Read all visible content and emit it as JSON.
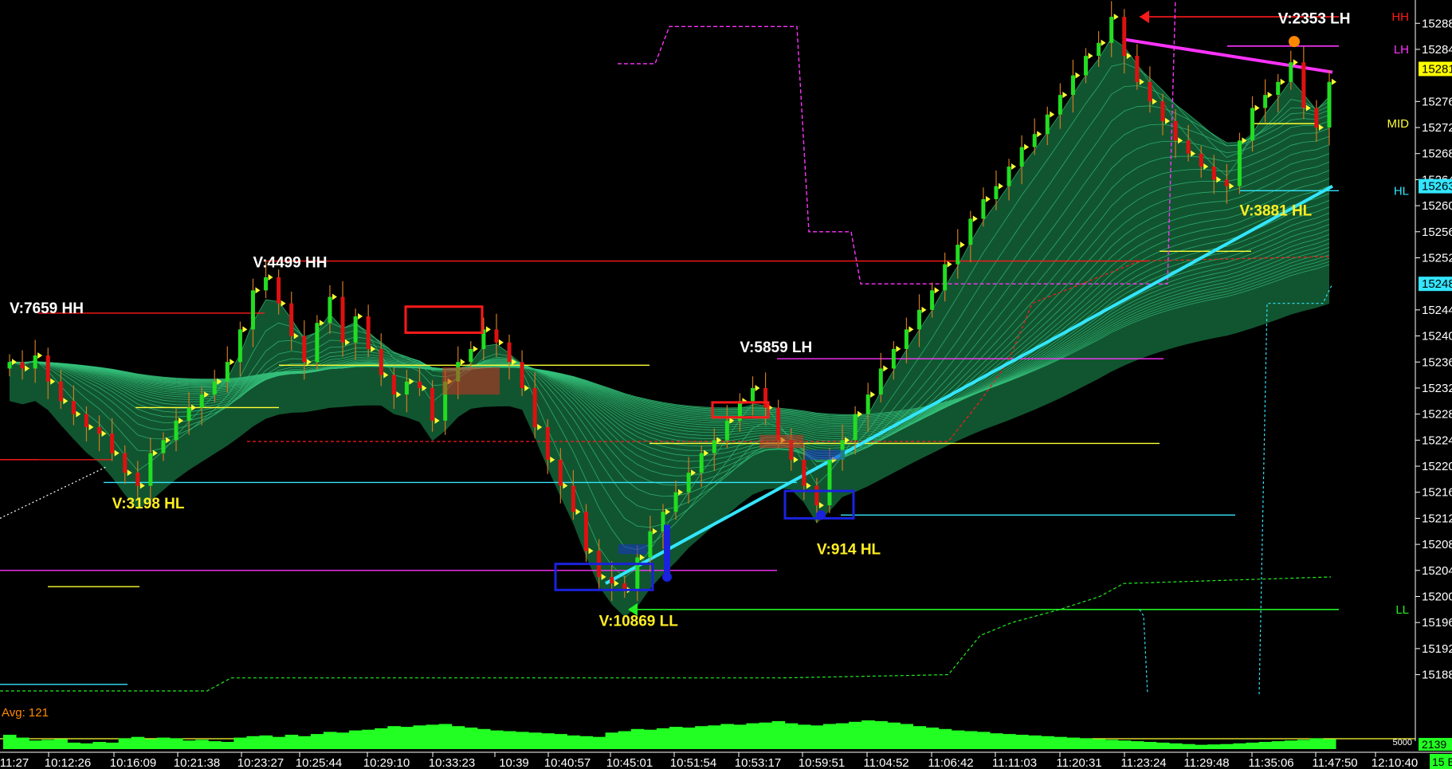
{
  "chart_data": {
    "type": "candlestick",
    "colors": {
      "background": "#000000",
      "up": "#22dd22",
      "down": "#dd1111",
      "ribbon": "#1f9a58",
      "swing_label": "#ffffff",
      "hl_label": "#ffee22",
      "cyan": "#33e6ff",
      "magenta": "#ff33ff",
      "red": "#ff1a1a",
      "yellow": "#ffff33",
      "green_line": "#22ee22",
      "blue": "#1a22dd",
      "volume": "#22ff22",
      "orange": "#ff8800"
    },
    "y_axis": {
      "ylim": [
        15184.4,
        15290.6
      ],
      "ticks": [
        "15288",
        "15284",
        "15276",
        "15272",
        "15268",
        "15264",
        "15260",
        "15256",
        "15252",
        "15244",
        "15240",
        "15236",
        "15232",
        "15228",
        "15224",
        "15220",
        "15216",
        "15212",
        "15208",
        "15204",
        "15200",
        "15196",
        "15192",
        "15188"
      ],
      "price_tags": [
        {
          "text": "15281",
          "value": 15281,
          "bg": "#ffff00",
          "fg": "#000000"
        },
        {
          "text": "15263",
          "value": 15263,
          "bg": "#33e6ff",
          "fg": "#000000"
        },
        {
          "text": "15248",
          "value": 15248,
          "bg": "#33e6ff",
          "fg": "#000000"
        }
      ]
    },
    "x_axis": {
      "ticks": [
        "11:27",
        "10:12:26",
        "10:16:09",
        "10:21:38",
        "10:23:27",
        "10:25:44",
        "10:29:10",
        "10:33:23",
        "10:39",
        "10:40:57",
        "10:45:01",
        "10:51:54",
        "10:53:17",
        "10:59:51",
        "11:04:52",
        "11:06:42",
        "11:11:03",
        "11:20:31",
        "11:23:24",
        "11:29:48",
        "11:35:06",
        "11:47:50",
        "12:10:40"
      ],
      "corner_label": "15 E"
    },
    "level_labels": [
      {
        "text": "HH",
        "value": 15289,
        "color": "#ff1a1a"
      },
      {
        "text": "LH",
        "value": 15284,
        "color": "#ff33ff"
      },
      {
        "text": "MID",
        "value": 15272.6,
        "color": "#ffff33"
      },
      {
        "text": "HL",
        "value": 15262.3,
        "color": "#33e6ff"
      },
      {
        "text": "LL",
        "value": 15198,
        "color": "#22ee22"
      }
    ],
    "swing_labels": [
      {
        "text": "V:7659 HH",
        "bar": 0,
        "value": 15243.5,
        "color": "#ffffff"
      },
      {
        "text": "V:4499 HH",
        "bar": 19,
        "value": 15250.5,
        "color": "#ffffff"
      },
      {
        "text": "V:3198 HL",
        "bar": 8,
        "value": 15213.5,
        "color": "#ffee22"
      },
      {
        "text": "V:5859 LH",
        "bar": 57,
        "value": 15237.5,
        "color": "#ffffff"
      },
      {
        "text": "V:10869 LL",
        "bar": 46,
        "value": 15195.5,
        "color": "#ffee22"
      },
      {
        "text": "V:914 HL",
        "bar": 63,
        "value": 15206.5,
        "color": "#ffee22"
      },
      {
        "text": "V:3881 HL",
        "bar": 96,
        "value": 15258.5,
        "color": "#ffee22"
      },
      {
        "text": "V:2353 LH",
        "bar": 99,
        "value": 15288,
        "color": "#ffffff"
      }
    ],
    "close": [
      15236,
      15235,
      15237,
      15233,
      15230,
      15228,
      15226,
      15225,
      15222,
      15219,
      15217,
      15222,
      15224,
      15227,
      15229,
      15231,
      15233,
      15236,
      15241,
      15247,
      15249,
      15245,
      15240,
      15236,
      15242,
      15246,
      15239,
      15243,
      15238,
      15234,
      15231,
      15233,
      15232,
      15227,
      15233,
      15236,
      15238,
      15241,
      15239,
      15236,
      15232,
      15226,
      15221,
      15217,
      15213,
      15207,
      15203,
      15202,
      15201,
      15206,
      15210,
      15213,
      15216,
      15219,
      15222,
      15224,
      15227,
      15230,
      15232,
      15229,
      15224,
      15221,
      15217,
      15214,
      15221,
      15224,
      15228,
      15231,
      15235,
      15238,
      15241,
      15244,
      15247,
      15251,
      15254,
      15258,
      15261,
      15263,
      15266,
      15269,
      15271,
      15274,
      15277,
      15280,
      15283,
      15285,
      15289,
      15283,
      15279,
      15276,
      15273,
      15270,
      15268,
      15266,
      15264,
      15263,
      15270,
      15275,
      15277,
      15279,
      15282,
      15275,
      15272,
      15279
    ]
  },
  "volume": {
    "avg_label": "Avg: 121",
    "level_label": "5000",
    "last_value": "2139",
    "values": [
      2000,
      1600,
      1200,
      1300,
      1400,
      900,
      800,
      1000,
      900,
      1500,
      1700,
      1400,
      1600,
      1500,
      1200,
      1300,
      1100,
      1000,
      1600,
      1800,
      1900,
      1700,
      2000,
      1800,
      2100,
      2400,
      2300,
      2600,
      2700,
      2900,
      3200,
      3100,
      3300,
      3400,
      3500,
      3200,
      3000,
      2800,
      2600,
      2500,
      2400,
      2300,
      2200,
      2100,
      1900,
      1800,
      1700,
      2300,
      2500,
      2800,
      2700,
      2900,
      3100,
      3000,
      3200,
      3300,
      3500,
      3400,
      3600,
      3700,
      3900,
      3600,
      3400,
      3300,
      3500,
      3600,
      3800,
      4000,
      3900,
      3700,
      3500,
      3200,
      3000,
      2800,
      2600,
      2500,
      2400,
      2200,
      2100,
      2000,
      1900,
      1800,
      1700,
      1600,
      1500,
      1400,
      1300,
      1200,
      1100,
      1000,
      900,
      800,
      700,
      600,
      650,
      700,
      800,
      900,
      1000,
      1100,
      1200,
      1300,
      1500,
      1400
    ]
  }
}
